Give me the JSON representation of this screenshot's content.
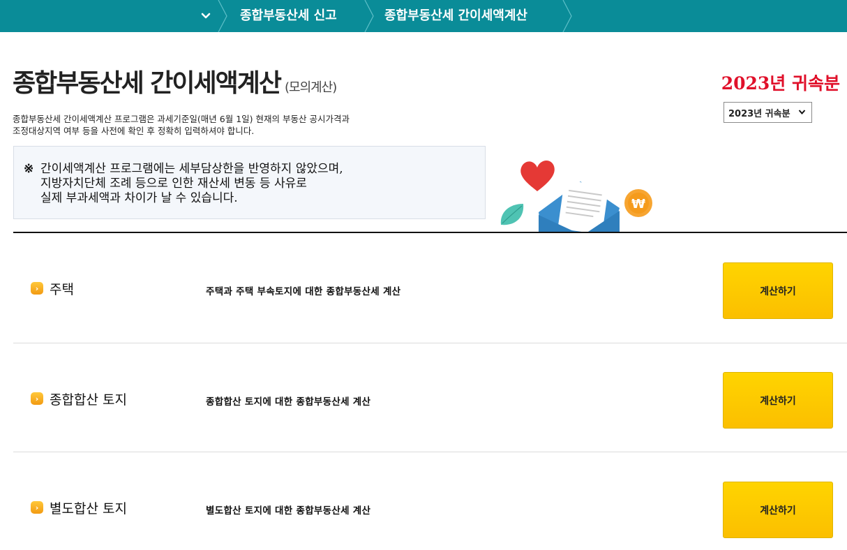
{
  "topbar": {
    "background": "#0a8c98",
    "toggle_icon": "chevron-down-icon",
    "breadcrumbs": [
      {
        "label": "종합부동산세 신고"
      },
      {
        "label": "종합부동산세 간이세액계산"
      }
    ]
  },
  "header": {
    "title": "종합부동산세 간이세액계산",
    "subtitle": "(모의계산)",
    "year_heading": "2023년 귀속분",
    "year_heading_color": "#e0102a",
    "year_select": {
      "selected": "2023년 귀속분"
    }
  },
  "description": {
    "line1": "종합부동산세 간이세액계산 프로그램은 과세기준일(매년 6월 1일) 현재의 부동산 공시가격과",
    "line2": "조정대상지역 여부 등을 사전에 확인 후 정확히 입력하셔야 합니다."
  },
  "notice": {
    "mark": "※",
    "line1": "간이세액계산 프로그램에는 세부담상한을 반영하지 않았으며,",
    "line2": "지방자치단체 조례 등으로 인한 재산세 변동 등 사유로",
    "line3": "실제 부과세액과 차이가 날 수 있습니다."
  },
  "illustration": {
    "icons": [
      "heart-icon",
      "envelope-icon",
      "leaf-icon",
      "won-coin-icon"
    ],
    "coin_symbol": "₩"
  },
  "rows": [
    {
      "title": "주택",
      "description": "주택과 주택 부속토지에 대한 종합부동산세 계산",
      "button": "계산하기"
    },
    {
      "title": "종합합산 토지",
      "description": "종합합산 토지에 대한 종합부동산세 계산",
      "button": "계산하기"
    },
    {
      "title": "별도합산 토지",
      "description": "별도합산 토지에 대한 종합부동산세 계산",
      "button": "계산하기"
    }
  ],
  "colors": {
    "button": "#ffd400",
    "bullet": "#f5a623"
  }
}
